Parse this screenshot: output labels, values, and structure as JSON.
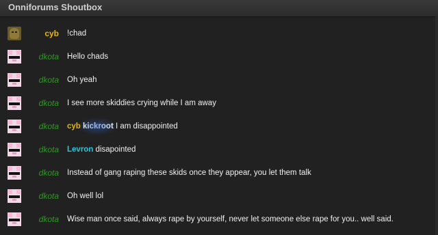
{
  "header": {
    "title": "Onniforums Shoutbox"
  },
  "messages": [
    {
      "user": "cyb",
      "avatar": "cyb-avatar",
      "text": "!chad"
    },
    {
      "user": "dkota",
      "avatar": "pig-avatar",
      "text": "Hello chads"
    },
    {
      "user": "dkota",
      "avatar": "pig-avatar",
      "text": "Oh yeah"
    },
    {
      "user": "dkota",
      "avatar": "pig-avatar",
      "text": "I see more skiddies crying while I am away"
    },
    {
      "user": "dkota",
      "avatar": "pig-avatar",
      "mentions": [
        "cyb",
        "kickroot"
      ],
      "text": "I am disappointed"
    },
    {
      "user": "dkota",
      "avatar": "pig-avatar",
      "mentions": [
        "Levron"
      ],
      "text": "disapointed"
    },
    {
      "user": "dkota",
      "avatar": "pig-avatar",
      "text": "Instead of gang raping these skids once they appear, you let them talk"
    },
    {
      "user": "dkota",
      "avatar": "pig-avatar",
      "text": "Oh well lol"
    },
    {
      "user": "dkota",
      "avatar": "pig-avatar",
      "text": "Wise man once said, always rape by yourself, never let someone else rape for you.. well said."
    }
  ],
  "colors": {
    "cyb": "#e2b51a",
    "dkota": "#2e9a23",
    "levron": "#28c3d6",
    "background": "#212121"
  }
}
